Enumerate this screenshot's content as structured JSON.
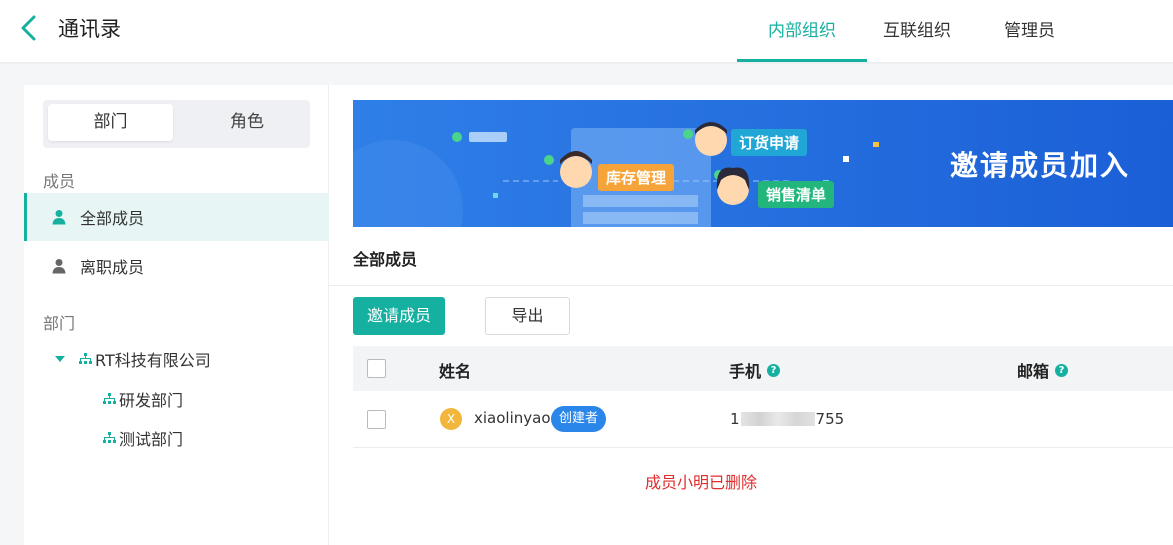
{
  "header": {
    "title": "通讯录",
    "tabs": [
      {
        "label": "内部组织",
        "active": true
      },
      {
        "label": "互联组织",
        "active": false
      },
      {
        "label": "管理员",
        "active": false
      }
    ]
  },
  "sidebar": {
    "segments": [
      "部门",
      "角色"
    ],
    "members_label": "成员",
    "member_items": [
      "全部成员",
      "离职成员"
    ],
    "dept_label": "部门",
    "company": "RT科技有限公司",
    "departments": [
      "研发部门",
      "测试部门"
    ]
  },
  "banner": {
    "tags": [
      "订货申请",
      "库存管理",
      "销售清单"
    ],
    "headline": "邀请成员加入"
  },
  "main": {
    "section_title": "全部成员",
    "invite_button": "邀请成员",
    "export_button": "导出",
    "columns": [
      "姓名",
      "手机",
      "邮箱"
    ],
    "help_glyph": "?",
    "rows": [
      {
        "avatar_letter": "X",
        "name": "xiaolinyao",
        "badge": "创建者",
        "phone_prefix": "1",
        "phone_suffix": "755"
      }
    ],
    "notice": "成员小明已删除"
  },
  "colors": {
    "accent": "#16b0a0",
    "badge": "#2a86e8",
    "notice": "#e02e2e",
    "avatar": "#f2b63c"
  }
}
